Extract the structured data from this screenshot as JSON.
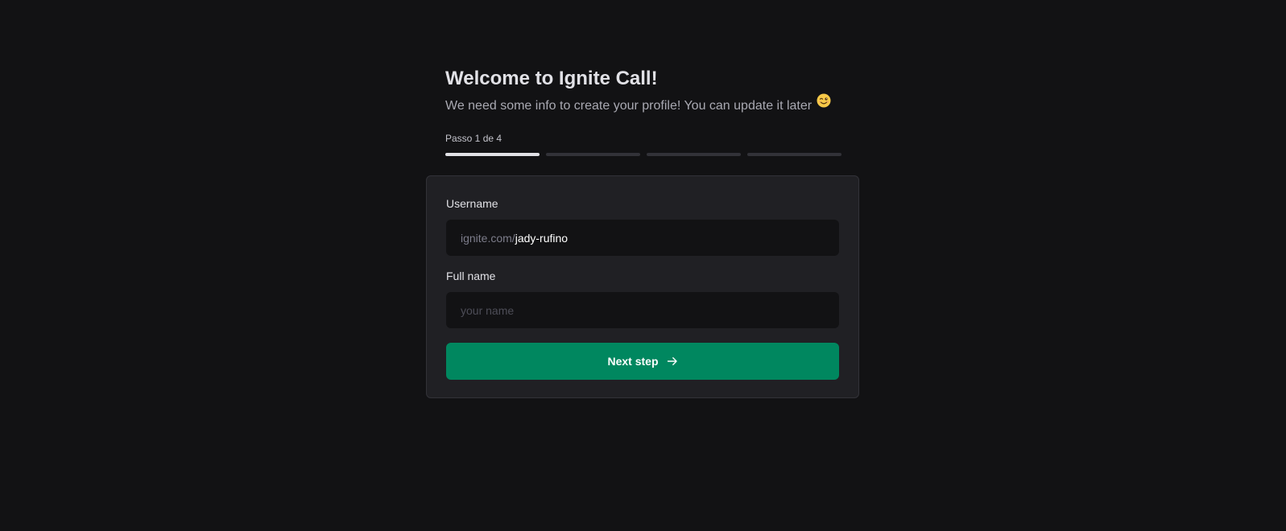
{
  "header": {
    "title": "Welcome to Ignite Call!",
    "subtitle": "We need some info to create your profile! You can update it later",
    "emoji_icon": "winking-face-emoji-icon"
  },
  "progress": {
    "label": "Passo 1 de 4",
    "current_step": 1,
    "total_steps": 4
  },
  "form": {
    "username": {
      "label": "Username",
      "prefix": "ignite.com/",
      "value": "jady-rufino"
    },
    "fullname": {
      "label": "Full name",
      "placeholder": "your name",
      "value": ""
    },
    "submit": {
      "label": "Next step",
      "icon": "arrow-right-icon"
    }
  },
  "colors": {
    "background": "#121214",
    "card": "#202024",
    "accent": "#00875f"
  }
}
